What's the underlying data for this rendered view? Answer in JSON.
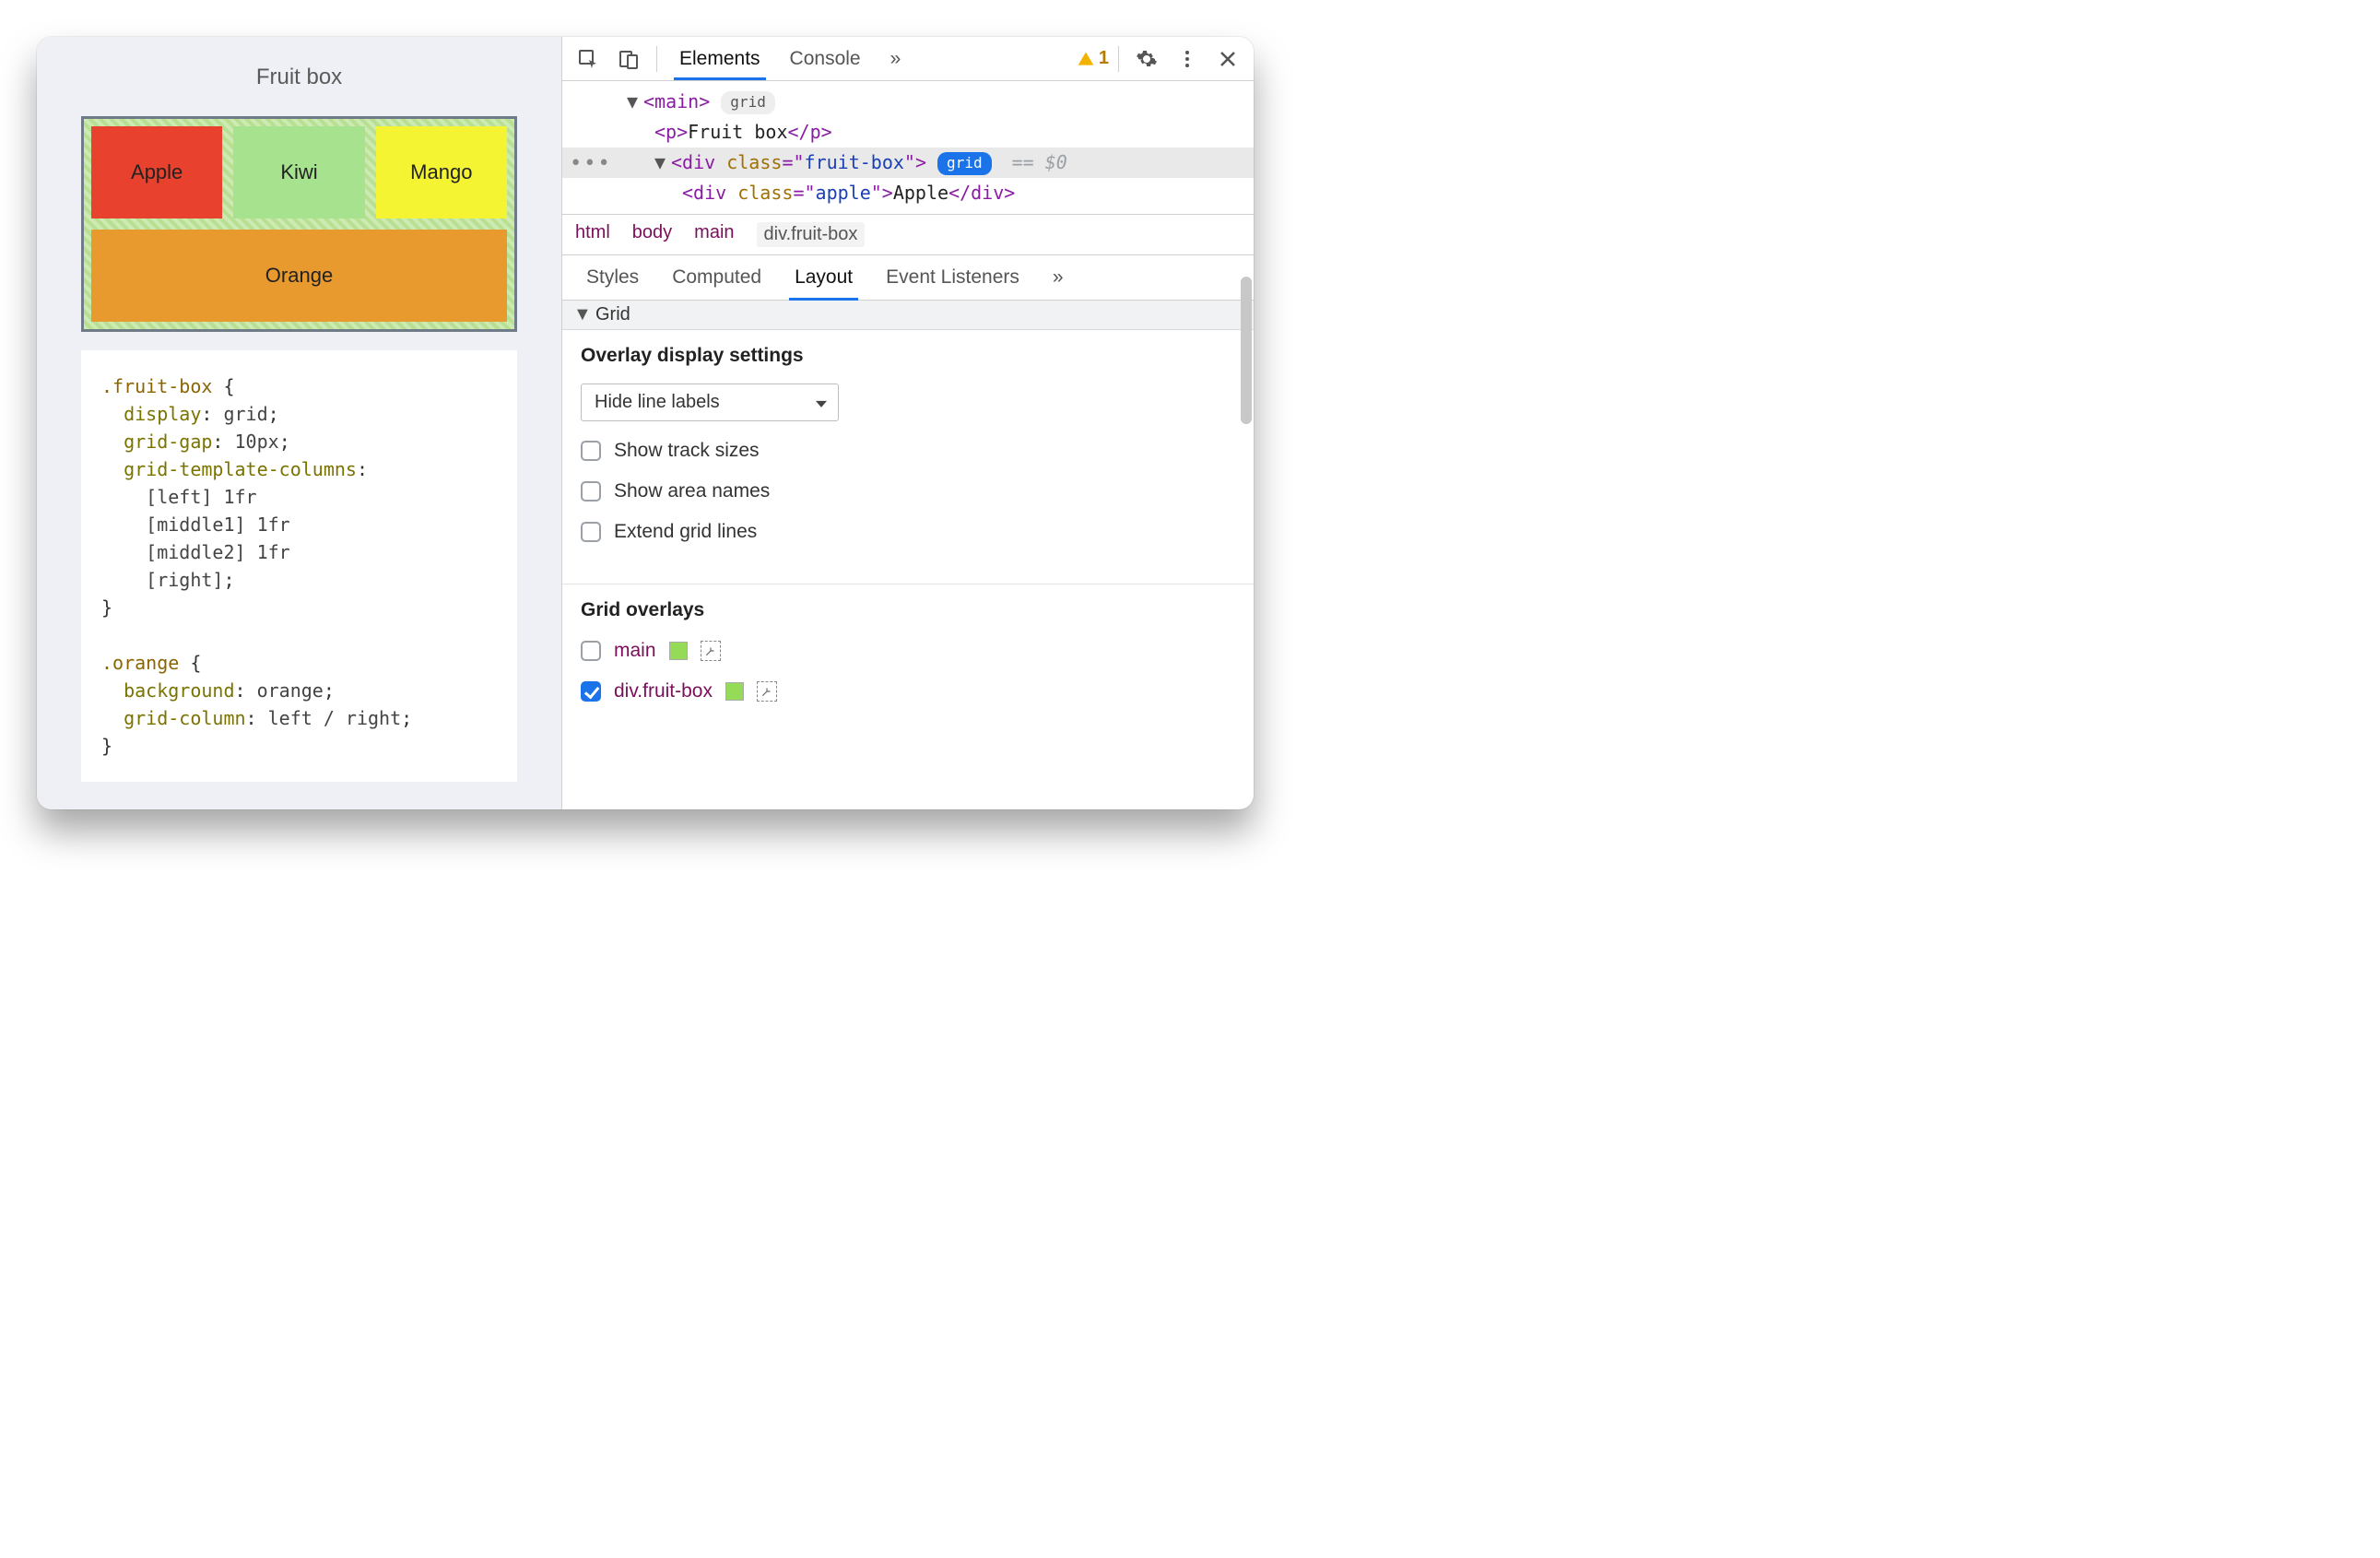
{
  "preview": {
    "title": "Fruit box",
    "cells": {
      "apple": "Apple",
      "kiwi": "Kiwi",
      "mango": "Mango",
      "orange": "Orange"
    },
    "code_lines": [
      [
        [
          "sel",
          ".fruit-box"
        ],
        [
          "punct",
          " {"
        ]
      ],
      [
        [
          "prop",
          "  display"
        ],
        [
          "punct",
          ": "
        ],
        [
          "val",
          "grid"
        ],
        [
          "punct",
          ";"
        ]
      ],
      [
        [
          "prop",
          "  grid-gap"
        ],
        [
          "punct",
          ": "
        ],
        [
          "val",
          "10px"
        ],
        [
          "punct",
          ";"
        ]
      ],
      [
        [
          "prop",
          "  grid-template-columns"
        ],
        [
          "punct",
          ":"
        ]
      ],
      [
        [
          "val",
          "    [left] 1fr"
        ]
      ],
      [
        [
          "val",
          "    [middle1] 1fr"
        ]
      ],
      [
        [
          "val",
          "    [middle2] 1fr"
        ]
      ],
      [
        [
          "val",
          "    [right]"
        ],
        [
          "punct",
          ";"
        ]
      ],
      [
        [
          "punct",
          "}"
        ]
      ],
      [
        [
          "punct",
          " "
        ]
      ],
      [
        [
          "sel",
          ".orange"
        ],
        [
          "punct",
          " {"
        ]
      ],
      [
        [
          "prop",
          "  background"
        ],
        [
          "punct",
          ": "
        ],
        [
          "val",
          "orange"
        ],
        [
          "punct",
          ";"
        ]
      ],
      [
        [
          "prop",
          "  grid-column"
        ],
        [
          "punct",
          ": "
        ],
        [
          "val",
          "left / right"
        ],
        [
          "punct",
          ";"
        ]
      ],
      [
        [
          "punct",
          "}"
        ]
      ]
    ]
  },
  "toolbar": {
    "tabs": {
      "elements": "Elements",
      "console": "Console"
    },
    "more": "»",
    "warning_count": "1"
  },
  "dom": {
    "main_badge": "grid",
    "fruitbox_badge": "grid",
    "sel_eq": "== $0",
    "rows": {
      "main_open": "<main>",
      "p_open": "<p>",
      "p_text": "Fruit box",
      "p_close": "</p>",
      "div_open": "<div ",
      "class_attr": "class",
      "fruitbox_val": "fruit-box",
      "apple_open": "<div ",
      "apple_val": "apple",
      "apple_text": "Apple",
      "div_close": "</div>"
    }
  },
  "breadcrumb": [
    "html",
    "body",
    "main",
    "div.fruit-box"
  ],
  "subtabs": {
    "styles": "Styles",
    "computed": "Computed",
    "layout": "Layout",
    "event": "Event Listeners",
    "more": "»"
  },
  "grid_section": {
    "title": "Grid",
    "overlay_settings_title": "Overlay display settings",
    "line_labels_select": "Hide line labels",
    "checkboxes": {
      "track_sizes": "Show track sizes",
      "area_names": "Show area names",
      "extend_lines": "Extend grid lines"
    },
    "overlays_title": "Grid overlays",
    "overlays": [
      {
        "name": "main",
        "checked": false
      },
      {
        "name": "div.fruit-box",
        "checked": true
      }
    ]
  }
}
